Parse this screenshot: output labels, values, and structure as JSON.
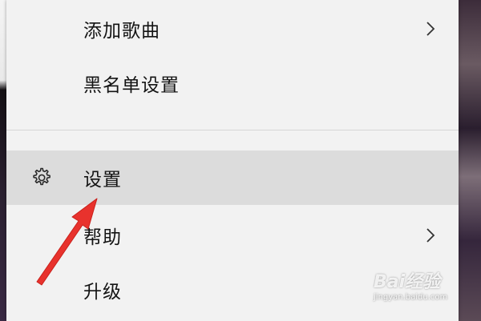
{
  "menu": {
    "items": [
      {
        "label": "添加歌曲",
        "has_submenu": true,
        "selected": false,
        "icon": null
      },
      {
        "label": "黑名单设置",
        "has_submenu": false,
        "selected": false,
        "icon": null
      },
      {
        "label": "设置",
        "has_submenu": false,
        "selected": true,
        "icon": "gear-icon"
      },
      {
        "label": "帮助",
        "has_submenu": true,
        "selected": false,
        "icon": null
      },
      {
        "label": "升级",
        "has_submenu": false,
        "selected": false,
        "icon": null
      }
    ]
  },
  "annotation": {
    "arrow_color": "#e8322d"
  },
  "watermark": {
    "logo": "Bai经验",
    "url": "jingyan.baidu.com"
  },
  "colors": {
    "menu_bg": "#f2f2f2",
    "selected_bg": "#dcdcdc",
    "text": "#141414"
  }
}
